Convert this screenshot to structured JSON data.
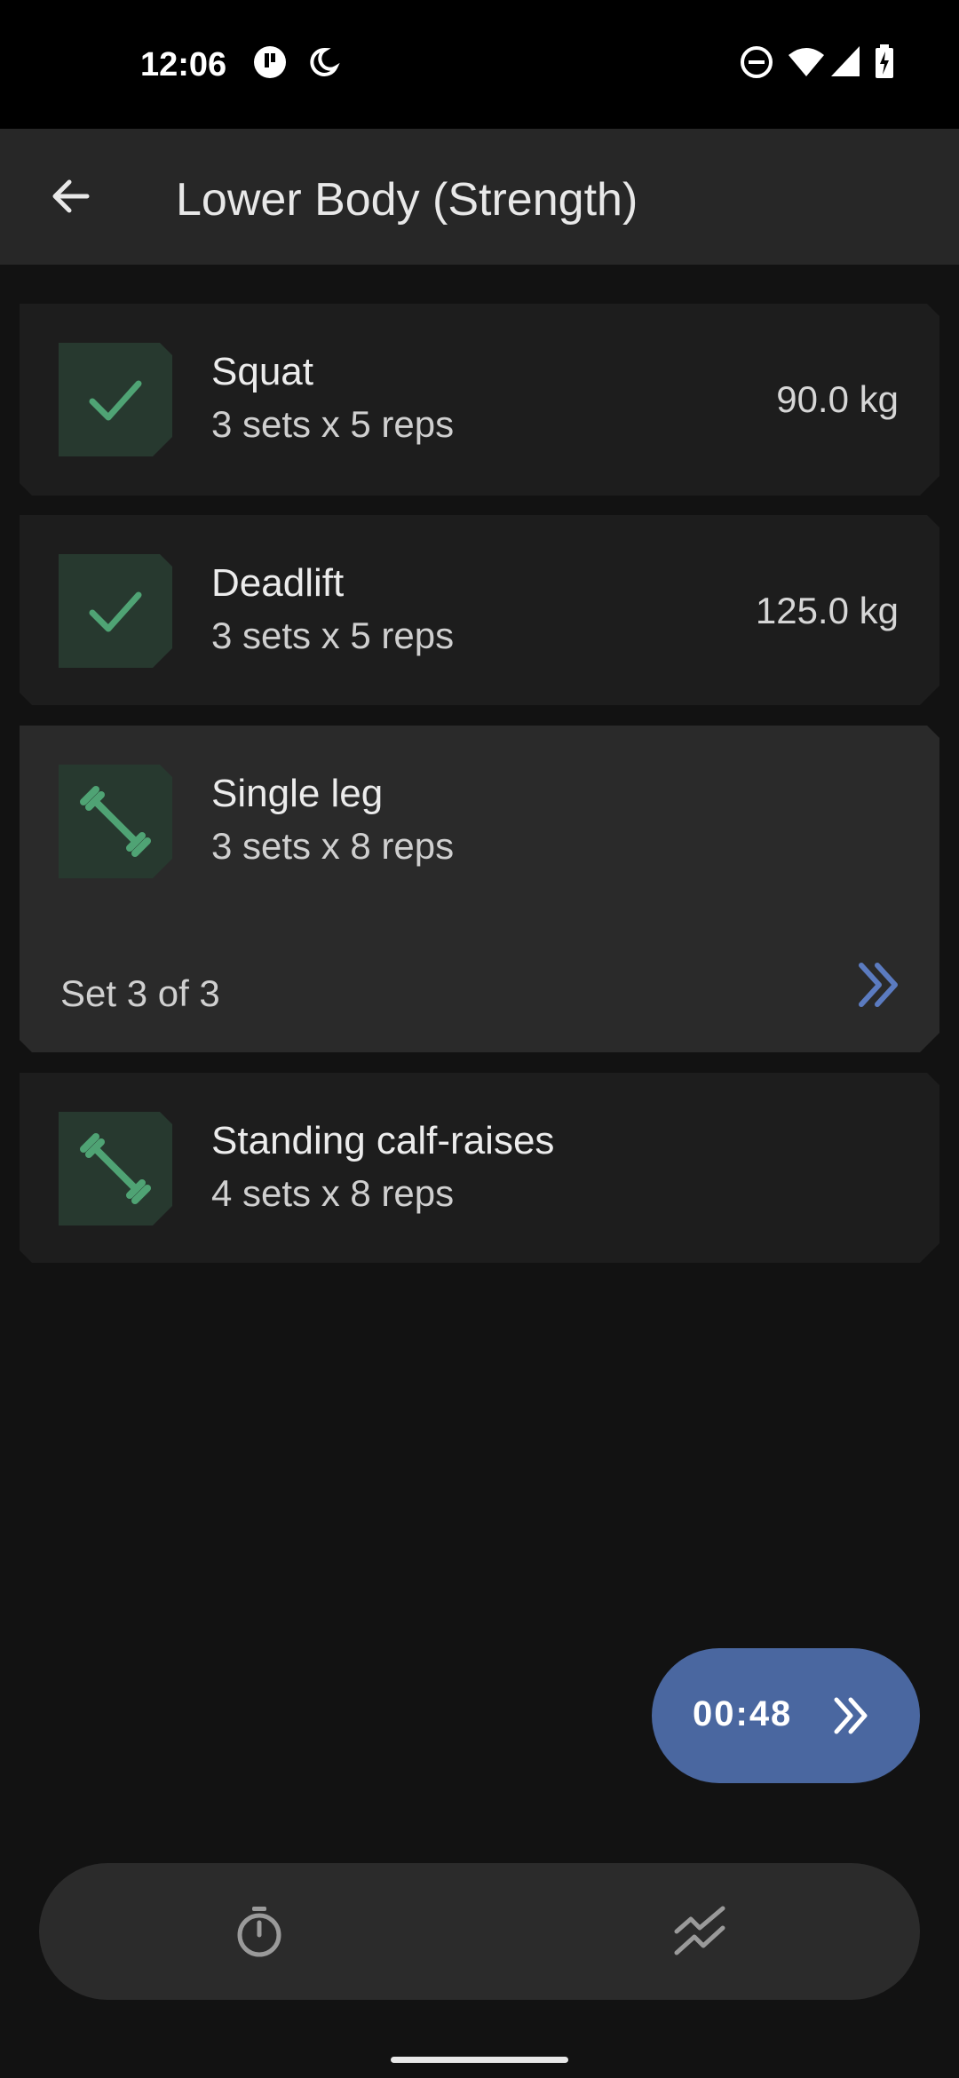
{
  "status_bar": {
    "time": "12:06"
  },
  "app_bar": {
    "title": "Lower Body (Strength)"
  },
  "exercises": [
    {
      "name": "Squat",
      "detail": "3 sets x 5 reps",
      "weight": "90.0 kg",
      "icon": "check-icon"
    },
    {
      "name": "Deadlift",
      "detail": "3 sets x 5 reps",
      "weight": "125.0 kg",
      "icon": "check-icon"
    },
    {
      "name": "Single leg",
      "detail": "3 sets x 8 reps",
      "icon": "dumbbell-icon",
      "set_progress": "Set 3 of 3"
    },
    {
      "name": "Standing calf-raises",
      "detail": "4 sets x 8 reps",
      "icon": "dumbbell-icon"
    }
  ],
  "rest_timer": {
    "time": "00:48",
    "icon": "double-chevron-right-icon"
  },
  "bottom_nav": [
    {
      "icon": "stopwatch-icon"
    },
    {
      "icon": "trend-chart-icon"
    }
  ],
  "colors": {
    "accent_green": "#4fa374",
    "accent_blue": "#4a67a0",
    "card_bg": "#1d1d1d",
    "active_card_bg": "#2a2a2a"
  }
}
